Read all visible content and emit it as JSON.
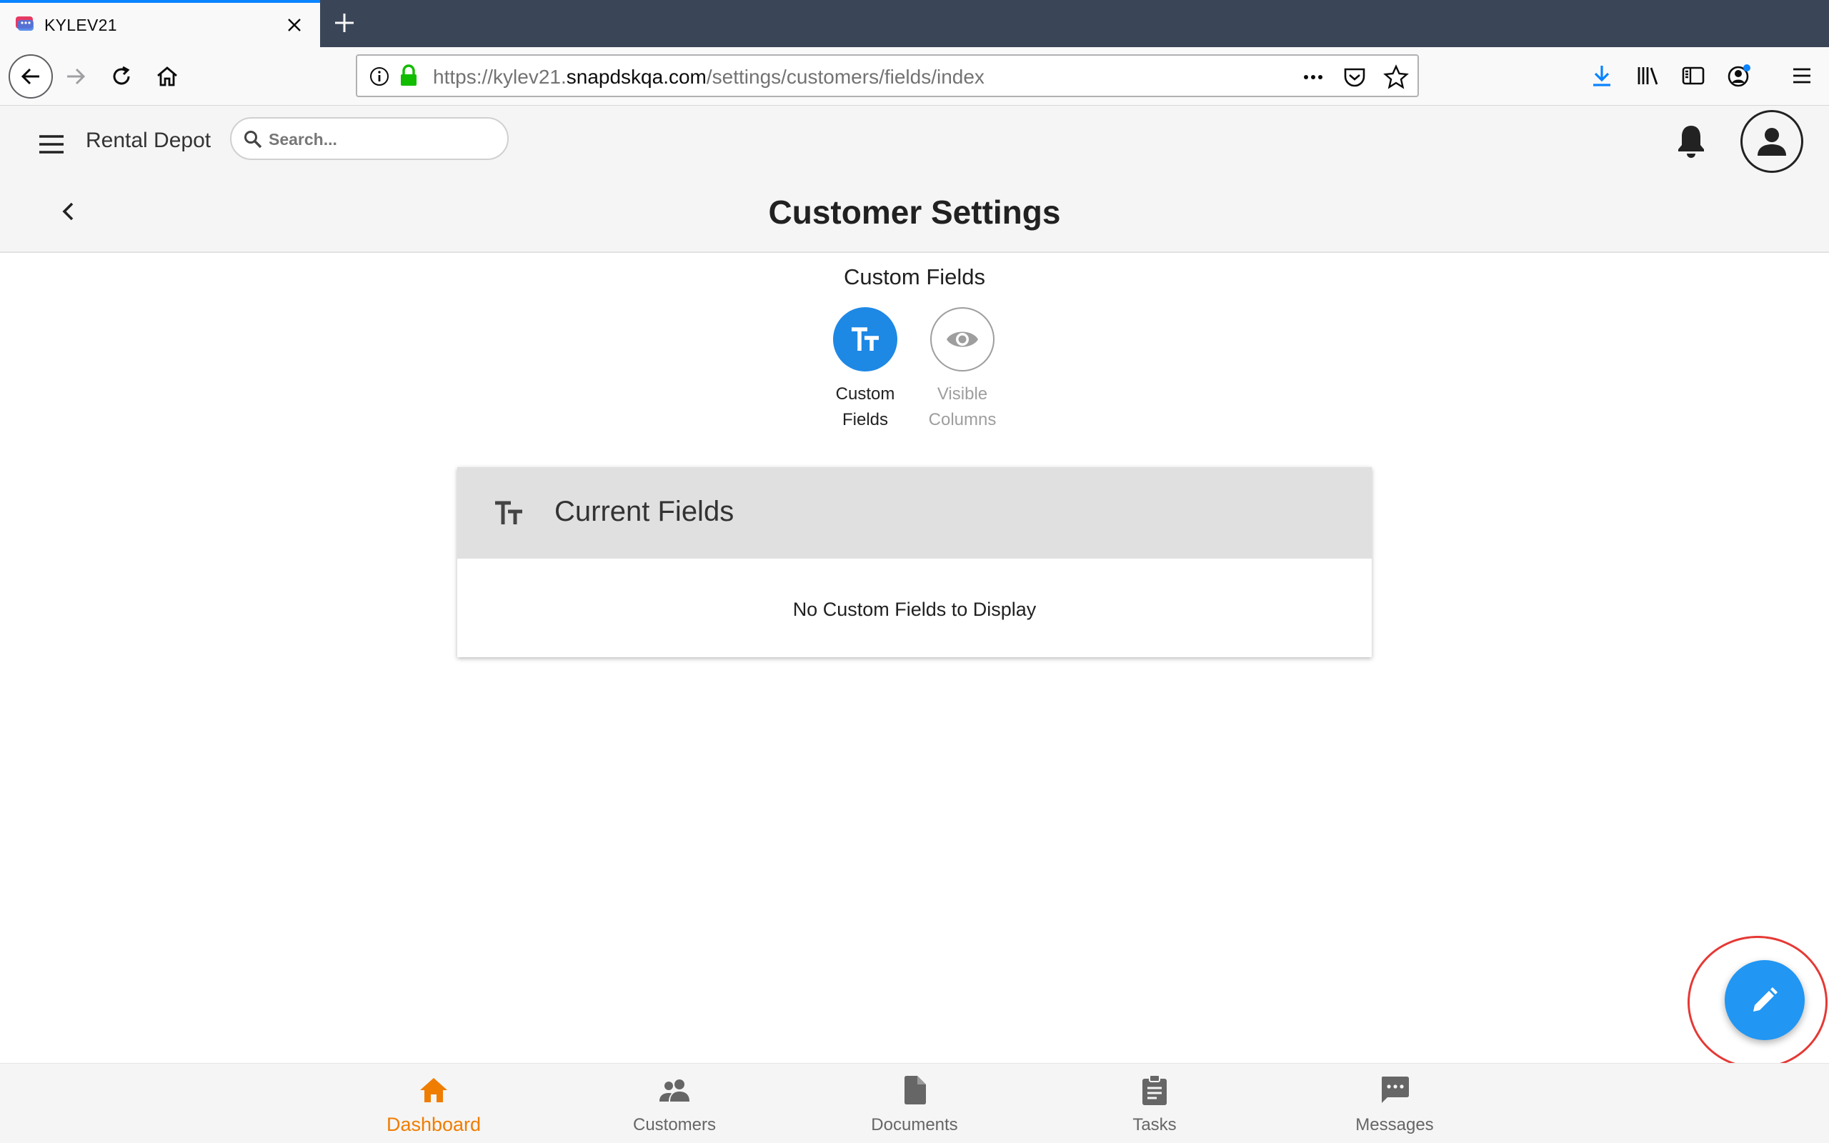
{
  "browser": {
    "tab_title": "KYLEV21",
    "url_scheme": "https://kylev21.",
    "url_host": "snapdskqa.com",
    "url_path": "/settings/customers/fields/index"
  },
  "header": {
    "brand": "Rental Depot",
    "search_placeholder": "Search...",
    "page_title": "Customer Settings"
  },
  "section": {
    "title": "Custom Fields",
    "modes": [
      {
        "label_line1": "Custom",
        "label_line2": "Fields",
        "active": true
      },
      {
        "label_line1": "Visible",
        "label_line2": "Columns",
        "active": false
      }
    ]
  },
  "card": {
    "title": "Current Fields",
    "empty_message": "No Custom Fields to Display"
  },
  "bottom_nav": {
    "items": [
      {
        "label": "Dashboard",
        "icon": "home-icon",
        "active": true
      },
      {
        "label": "Customers",
        "icon": "people-icon",
        "active": false
      },
      {
        "label": "Documents",
        "icon": "document-icon",
        "active": false
      },
      {
        "label": "Tasks",
        "icon": "clipboard-icon",
        "active": false
      },
      {
        "label": "Messages",
        "icon": "chat-icon",
        "active": false
      }
    ]
  },
  "colors": {
    "accent_blue": "#2196f3",
    "active_orange": "#ef7d00",
    "highlight_ring": "#e53935"
  }
}
